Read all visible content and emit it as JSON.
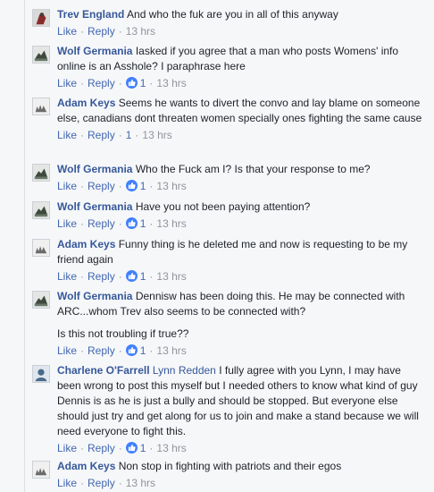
{
  "comments": [
    {
      "author": "Trev England",
      "text": "And who the fuk are you in all of this anyway",
      "like_label": "Like",
      "reply_label": "Reply",
      "reaction_count": "",
      "time": "13 hrs",
      "avatar_color": "#8a2b2b"
    },
    {
      "author": "Wolf Germania",
      "text": "Iasked if you agree that a man who posts Womens' info online is an Asshole? I paraphrase here",
      "like_label": "Like",
      "reply_label": "Reply",
      "reaction_count": "1",
      "time": "13 hrs",
      "avatar_color": "#3d4a3d"
    },
    {
      "author": "Adam Keys",
      "text": "Seems he wants to divert the convo and lay blame on someone else, canadians dont threaten women specially ones fighting the same cause",
      "like_label": "Like",
      "reply_label": "Reply",
      "reaction_count": "1",
      "time": "13 hrs",
      "avatar_color": "#6b6b6b"
    },
    {
      "author": "Wolf Germania",
      "text": "Who the Fuck am I? Is that your response to me?",
      "like_label": "Like",
      "reply_label": "Reply",
      "reaction_count": "1",
      "time": "13 hrs",
      "avatar_color": "#3d4a3d"
    },
    {
      "author": "Wolf Germania",
      "text": "Have you not been paying attention?",
      "like_label": "Like",
      "reply_label": "Reply",
      "reaction_count": "1",
      "time": "13 hrs",
      "avatar_color": "#3d4a3d"
    },
    {
      "author": "Adam Keys",
      "text": "Funny thing is he deleted me and now is requesting to be my friend again",
      "like_label": "Like",
      "reply_label": "Reply",
      "reaction_count": "1",
      "time": "13 hrs",
      "avatar_color": "#6b6b6b"
    },
    {
      "author": "Wolf Germania",
      "text": "Dennisw has been doing this. He may be connected with ARC...whom Trev also seems to be connected with?",
      "extra": "Is this not troubling if true??",
      "like_label": "Like",
      "reply_label": "Reply",
      "reaction_count": "1",
      "time": "13 hrs",
      "avatar_color": "#3d4a3d"
    },
    {
      "author": "Charlene O'Farrell",
      "mention": "Lynn Redden",
      "text": "I fully agree with you Lynn, I may have been wrong to post this myself but I needed others to know what kind of guy Dennis is as he is just a bully and should be stopped. But everyone else should just try and get along for us to join and make a stand because we will need everyone to fight this.",
      "like_label": "Like",
      "reply_label": "Reply",
      "reaction_count": "1",
      "time": "13 hrs",
      "avatar_color": "#4a6a8a"
    },
    {
      "author": "Adam Keys",
      "text": "Non stop in fighting with patriots and their egos",
      "like_label": "Like",
      "reply_label": "Reply",
      "reaction_count": "",
      "time": "13 hrs",
      "avatar_color": "#6b6b6b"
    }
  ],
  "colors": {
    "author": "#365899",
    "link": "#4267b2",
    "meta": "#90949c",
    "like_badge": "#4080ff"
  }
}
